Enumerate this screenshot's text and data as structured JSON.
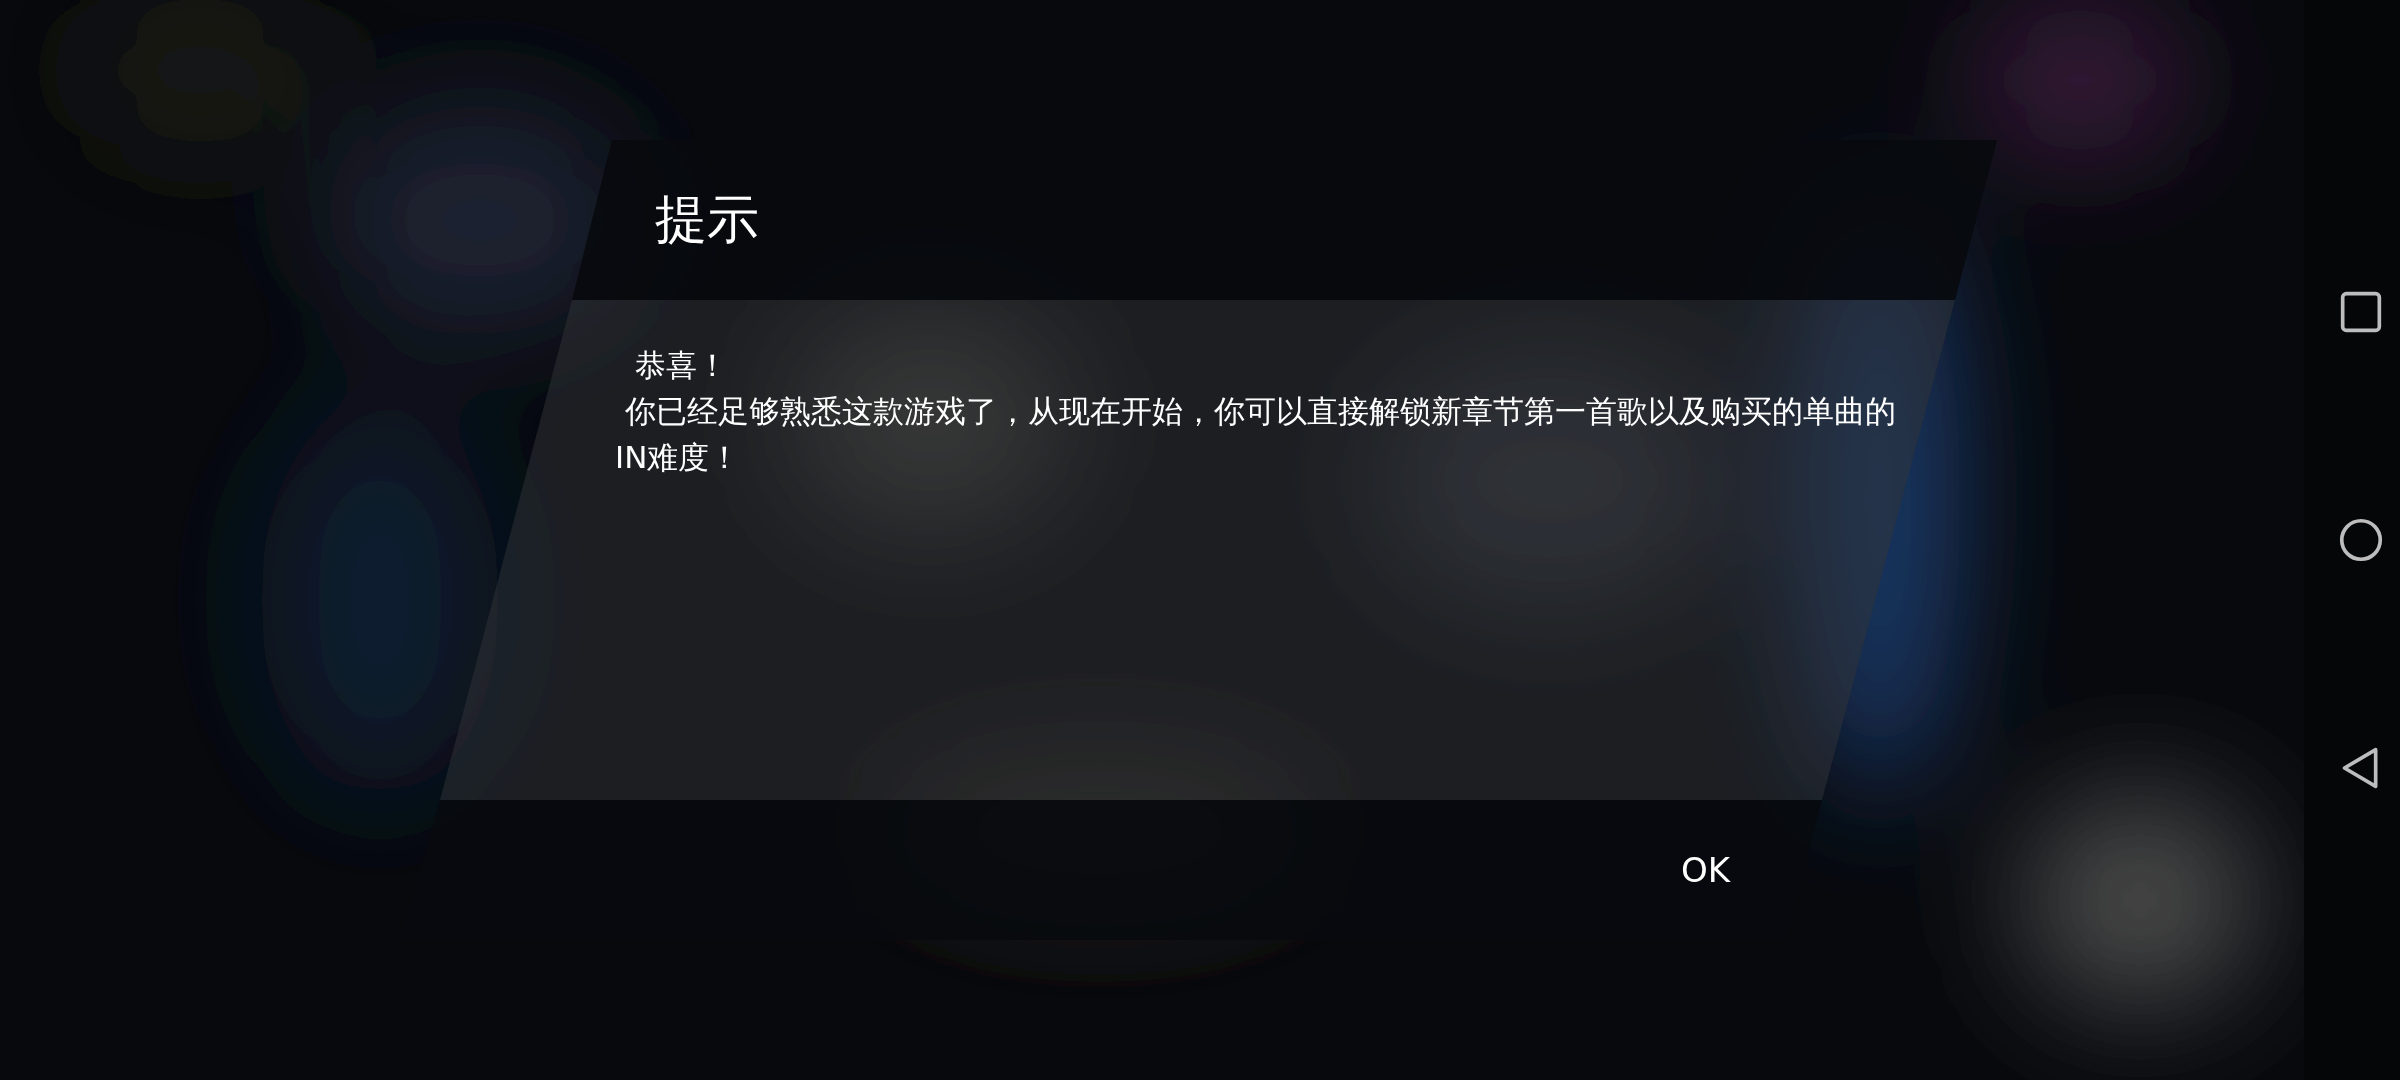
{
  "dialog": {
    "title": "提示",
    "message": [
      "  恭喜！",
      " 你已经足够熟悉这款游戏了，从现在开始，你可以直接解锁新章节第一首歌以及购买的单曲的 IN难度！"
    ],
    "buttons": [
      "OK"
    ]
  },
  "nav_bar": [
    {
      "kind": "recents"
    },
    {
      "kind": "home"
    },
    {
      "kind": "back"
    }
  ]
}
